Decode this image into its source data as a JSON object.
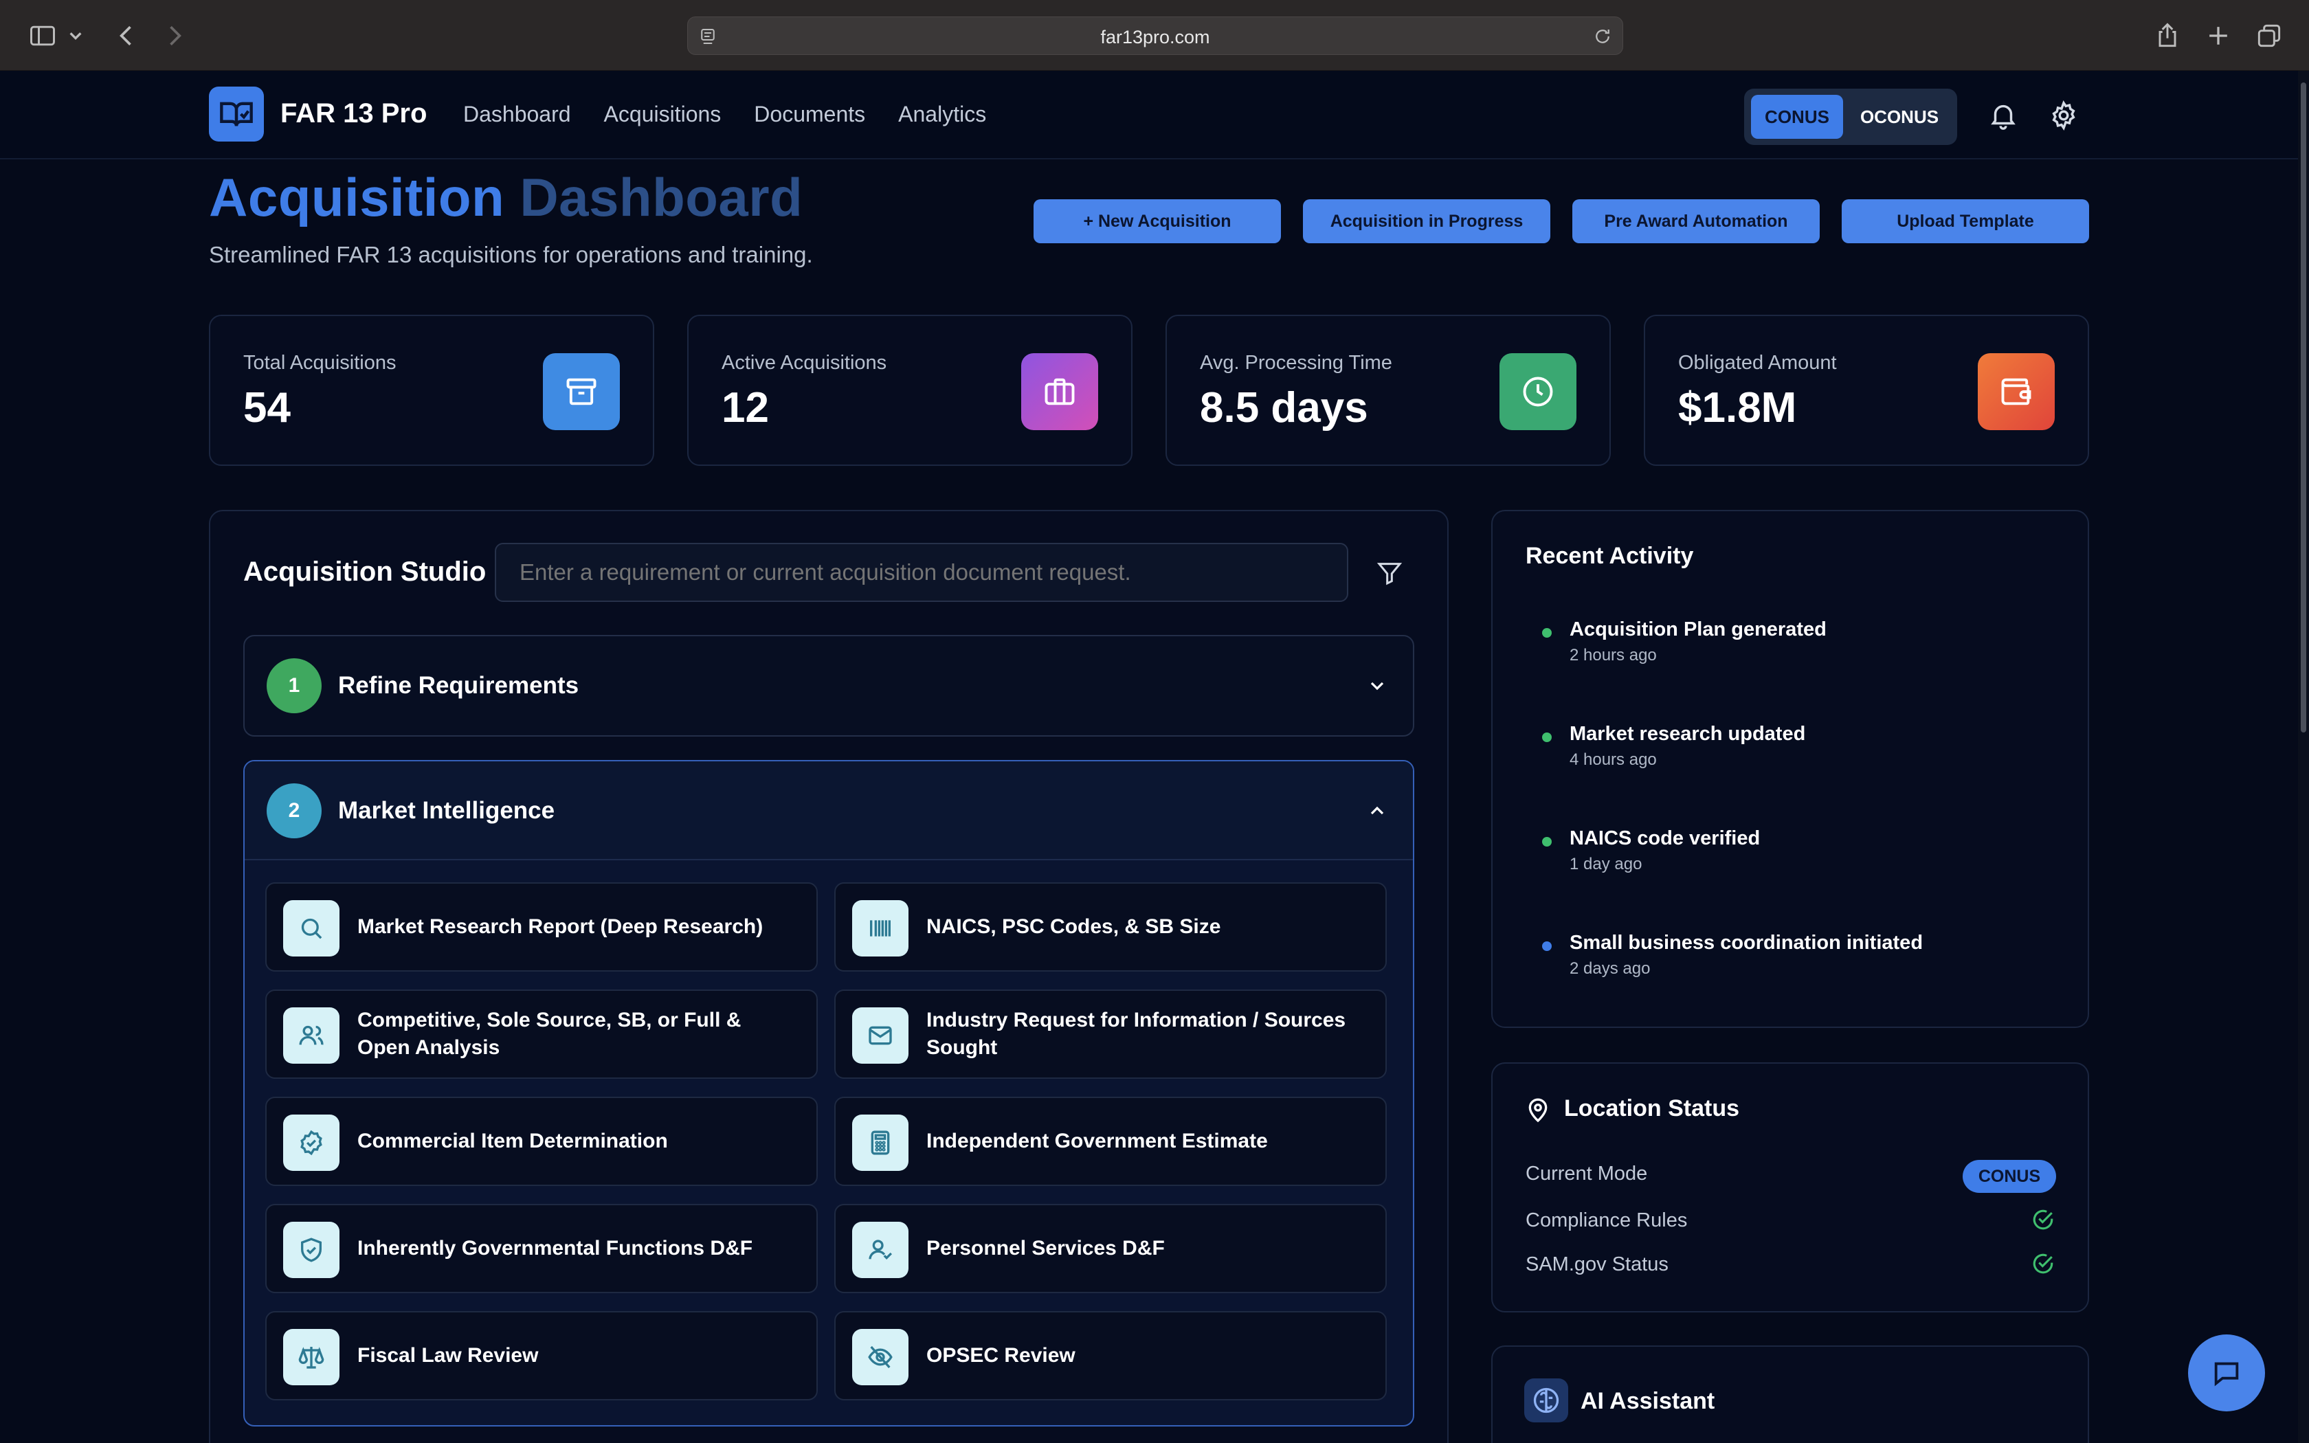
{
  "browser": {
    "url": "far13pro.com"
  },
  "header": {
    "brand": "FAR 13 Pro",
    "nav": [
      "Dashboard",
      "Acquisitions",
      "Documents",
      "Analytics"
    ],
    "mode_conus": "CONUS",
    "mode_oconus": "OCONUS"
  },
  "page": {
    "title_part1": "Acquisition",
    "title_part2": "Dashboard",
    "subtitle": "Streamlined FAR 13 acquisitions for operations and training.",
    "actions": [
      "+ New Acquisition",
      "Acquisition in Progress",
      "Pre Award Automation",
      "Upload Template"
    ]
  },
  "stats": [
    {
      "label": "Total Acquisitions",
      "value": "54",
      "icon": "archive-icon",
      "color": "#3f8be3"
    },
    {
      "label": "Active Acquisitions",
      "value": "12",
      "icon": "briefcase-icon",
      "color": "#b04fd6"
    },
    {
      "label": "Avg. Processing Time",
      "value": "8.5 days",
      "icon": "clock-icon",
      "color": "#3aa872"
    },
    {
      "label": "Obligated Amount",
      "value": "$1.8M",
      "icon": "wallet-icon",
      "color": "#e8603a"
    }
  ],
  "studio": {
    "title": "Acquisition Studio",
    "placeholder": "Enter a requirement or current acquisition document request.",
    "steps": [
      {
        "number": "1",
        "name": "Refine Requirements",
        "color": "#3fa85f",
        "expanded": false
      },
      {
        "number": "2",
        "name": "Market Intelligence",
        "color": "#3aa1c4",
        "expanded": true
      }
    ],
    "tiles": [
      {
        "label": "Market Research Report (Deep Research)",
        "icon": "search-icon"
      },
      {
        "label": "NAICS, PSC Codes, & SB Size",
        "icon": "barcode-icon"
      },
      {
        "label": "Competitive, Sole Source, SB, or Full & Open Analysis",
        "icon": "users-icon"
      },
      {
        "label": "Industry Request for Information / Sources Sought",
        "icon": "mail-icon"
      },
      {
        "label": "Commercial Item Determination",
        "icon": "badge-check-icon"
      },
      {
        "label": "Independent Government Estimate",
        "icon": "calculator-icon"
      },
      {
        "label": "Inherently Governmental Functions D&F",
        "icon": "shield-check-icon"
      },
      {
        "label": "Personnel Services D&F",
        "icon": "user-check-icon"
      },
      {
        "label": "Fiscal Law Review",
        "icon": "scale-icon"
      },
      {
        "label": "OPSEC Review",
        "icon": "eye-off-icon"
      }
    ]
  },
  "activity": {
    "title": "Recent Activity",
    "items": [
      {
        "title": "Acquisition Plan generated",
        "time": "2 hours ago",
        "color": "#3fbf6e"
      },
      {
        "title": "Market research updated",
        "time": "4 hours ago",
        "color": "#3fbf6e"
      },
      {
        "title": "NAICS code verified",
        "time": "1 day ago",
        "color": "#3fbf6e"
      },
      {
        "title": "Small business coordination initiated",
        "time": "2 days ago",
        "color": "#3f7de8"
      }
    ]
  },
  "location": {
    "title": "Location Status",
    "current_mode_label": "Current Mode",
    "current_mode_value": "CONUS",
    "compliance_label": "Compliance Rules",
    "sam_label": "SAM.gov Status"
  },
  "assistant": {
    "title": "AI Assistant"
  }
}
